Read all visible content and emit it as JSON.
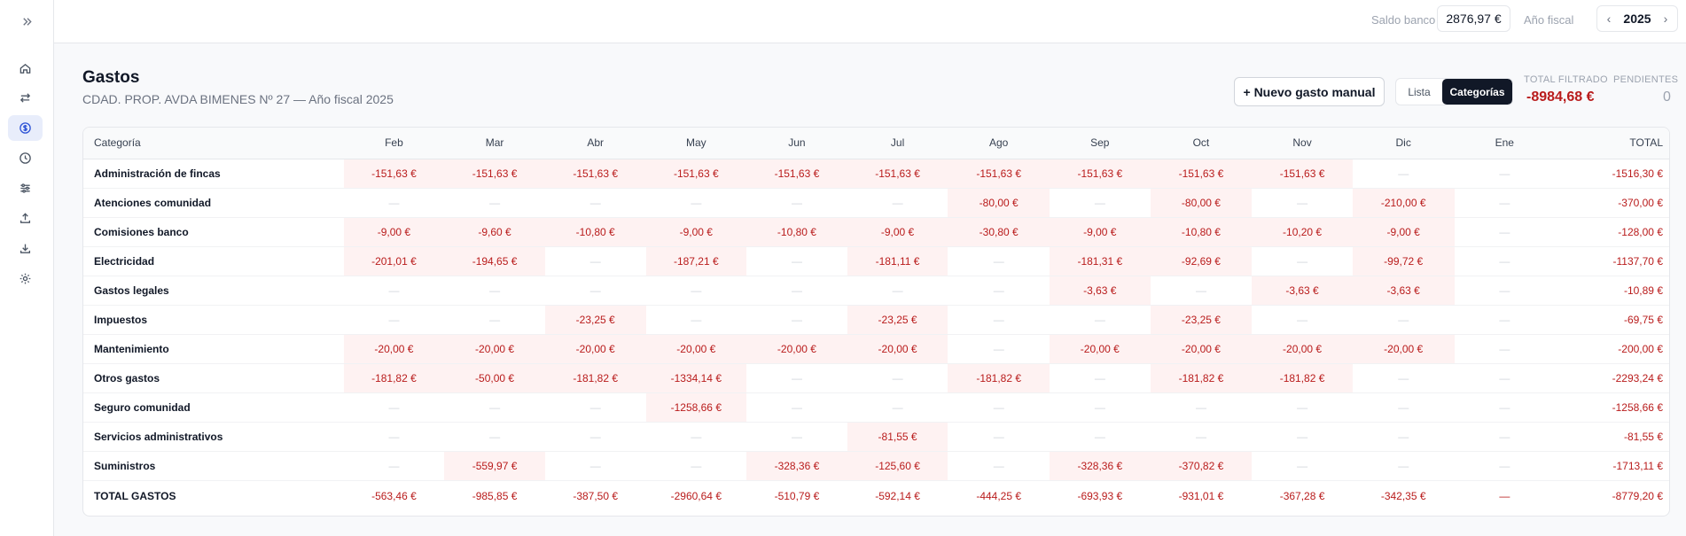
{
  "topbar": {
    "bank_label": "Saldo banco",
    "bank_value": "2876,97 €",
    "fiscal_label": "Año fiscal",
    "fiscal_year": "2025"
  },
  "page": {
    "title": "Gastos",
    "subtitle": "CDAD. PROP. AVDA BIMENES Nº 27 — Año fiscal 2025"
  },
  "actions": {
    "new_label": "+ Nuevo gasto manual",
    "view_list": "Lista",
    "view_categories": "Categorías"
  },
  "stats": {
    "total_label": "TOTAL FILTRADO",
    "total_value": "-8984,68 €",
    "pending_label": "PENDIENTES",
    "pending_value": "0"
  },
  "colors": {
    "accent": "#2f54d6",
    "negative": "#b91c1c",
    "negative_bg": "#fef2f2",
    "dark": "#111827"
  },
  "sidebar": {
    "items": [
      "home-icon",
      "transfer-icon",
      "dollar-icon",
      "clock-icon",
      "sliders-icon",
      "upload-icon",
      "download-icon",
      "gear-icon"
    ]
  },
  "table": {
    "headers": [
      "Categoría",
      "Feb",
      "Mar",
      "Abr",
      "May",
      "Jun",
      "Jul",
      "Ago",
      "Sep",
      "Oct",
      "Nov",
      "Dic",
      "Ene",
      "TOTAL"
    ],
    "rows": [
      [
        "Administración de fincas",
        "-151,63 €",
        "-151,63 €",
        "-151,63 €",
        "-151,63 €",
        "-151,63 €",
        "-151,63 €",
        "-151,63 €",
        "-151,63 €",
        "-151,63 €",
        "-151,63 €",
        "—",
        "—",
        "-1516,30 €"
      ],
      [
        "Atenciones comunidad",
        "—",
        "—",
        "—",
        "—",
        "—",
        "—",
        "-80,00 €",
        "—",
        "-80,00 €",
        "—",
        "-210,00 €",
        "—",
        "-370,00 €"
      ],
      [
        "Comisiones banco",
        "-9,00 €",
        "-9,60 €",
        "-10,80 €",
        "-9,00 €",
        "-10,80 €",
        "-9,00 €",
        "-30,80 €",
        "-9,00 €",
        "-10,80 €",
        "-10,20 €",
        "-9,00 €",
        "—",
        "-128,00 €"
      ],
      [
        "Electricidad",
        "-201,01 €",
        "-194,65 €",
        "—",
        "-187,21 €",
        "—",
        "-181,11 €",
        "—",
        "-181,31 €",
        "-92,69 €",
        "—",
        "-99,72 €",
        "—",
        "-1137,70 €"
      ],
      [
        "Gastos legales",
        "—",
        "—",
        "—",
        "—",
        "—",
        "—",
        "—",
        "-3,63 €",
        "—",
        "-3,63 €",
        "-3,63 €",
        "—",
        "-10,89 €"
      ],
      [
        "Impuestos",
        "—",
        "—",
        "-23,25 €",
        "—",
        "—",
        "-23,25 €",
        "—",
        "—",
        "-23,25 €",
        "—",
        "—",
        "—",
        "-69,75 €"
      ],
      [
        "Mantenimiento",
        "-20,00 €",
        "-20,00 €",
        "-20,00 €",
        "-20,00 €",
        "-20,00 €",
        "-20,00 €",
        "—",
        "-20,00 €",
        "-20,00 €",
        "-20,00 €",
        "-20,00 €",
        "—",
        "-200,00 €"
      ],
      [
        "Otros gastos",
        "-181,82 €",
        "-50,00 €",
        "-181,82 €",
        "-1334,14 €",
        "—",
        "—",
        "-181,82 €",
        "—",
        "-181,82 €",
        "-181,82 €",
        "—",
        "—",
        "-2293,24 €"
      ],
      [
        "Seguro comunidad",
        "—",
        "—",
        "—",
        "-1258,66 €",
        "—",
        "—",
        "—",
        "—",
        "—",
        "—",
        "—",
        "—",
        "-1258,66 €"
      ],
      [
        "Servicios administrativos",
        "—",
        "—",
        "—",
        "—",
        "—",
        "-81,55 €",
        "—",
        "—",
        "—",
        "—",
        "—",
        "—",
        "-81,55 €"
      ],
      [
        "Suministros",
        "—",
        "-559,97 €",
        "—",
        "—",
        "-328,36 €",
        "-125,60 €",
        "—",
        "-328,36 €",
        "-370,82 €",
        "—",
        "—",
        "—",
        "-1713,11 €"
      ]
    ],
    "footer": [
      "TOTAL GASTOS",
      "-563,46 €",
      "-985,85 €",
      "-387,50 €",
      "-2960,64 €",
      "-510,79 €",
      "-592,14 €",
      "-444,25 €",
      "-693,93 €",
      "-931,01 €",
      "-367,28 €",
      "-342,35 €",
      "—",
      "-8779,20 €"
    ]
  }
}
